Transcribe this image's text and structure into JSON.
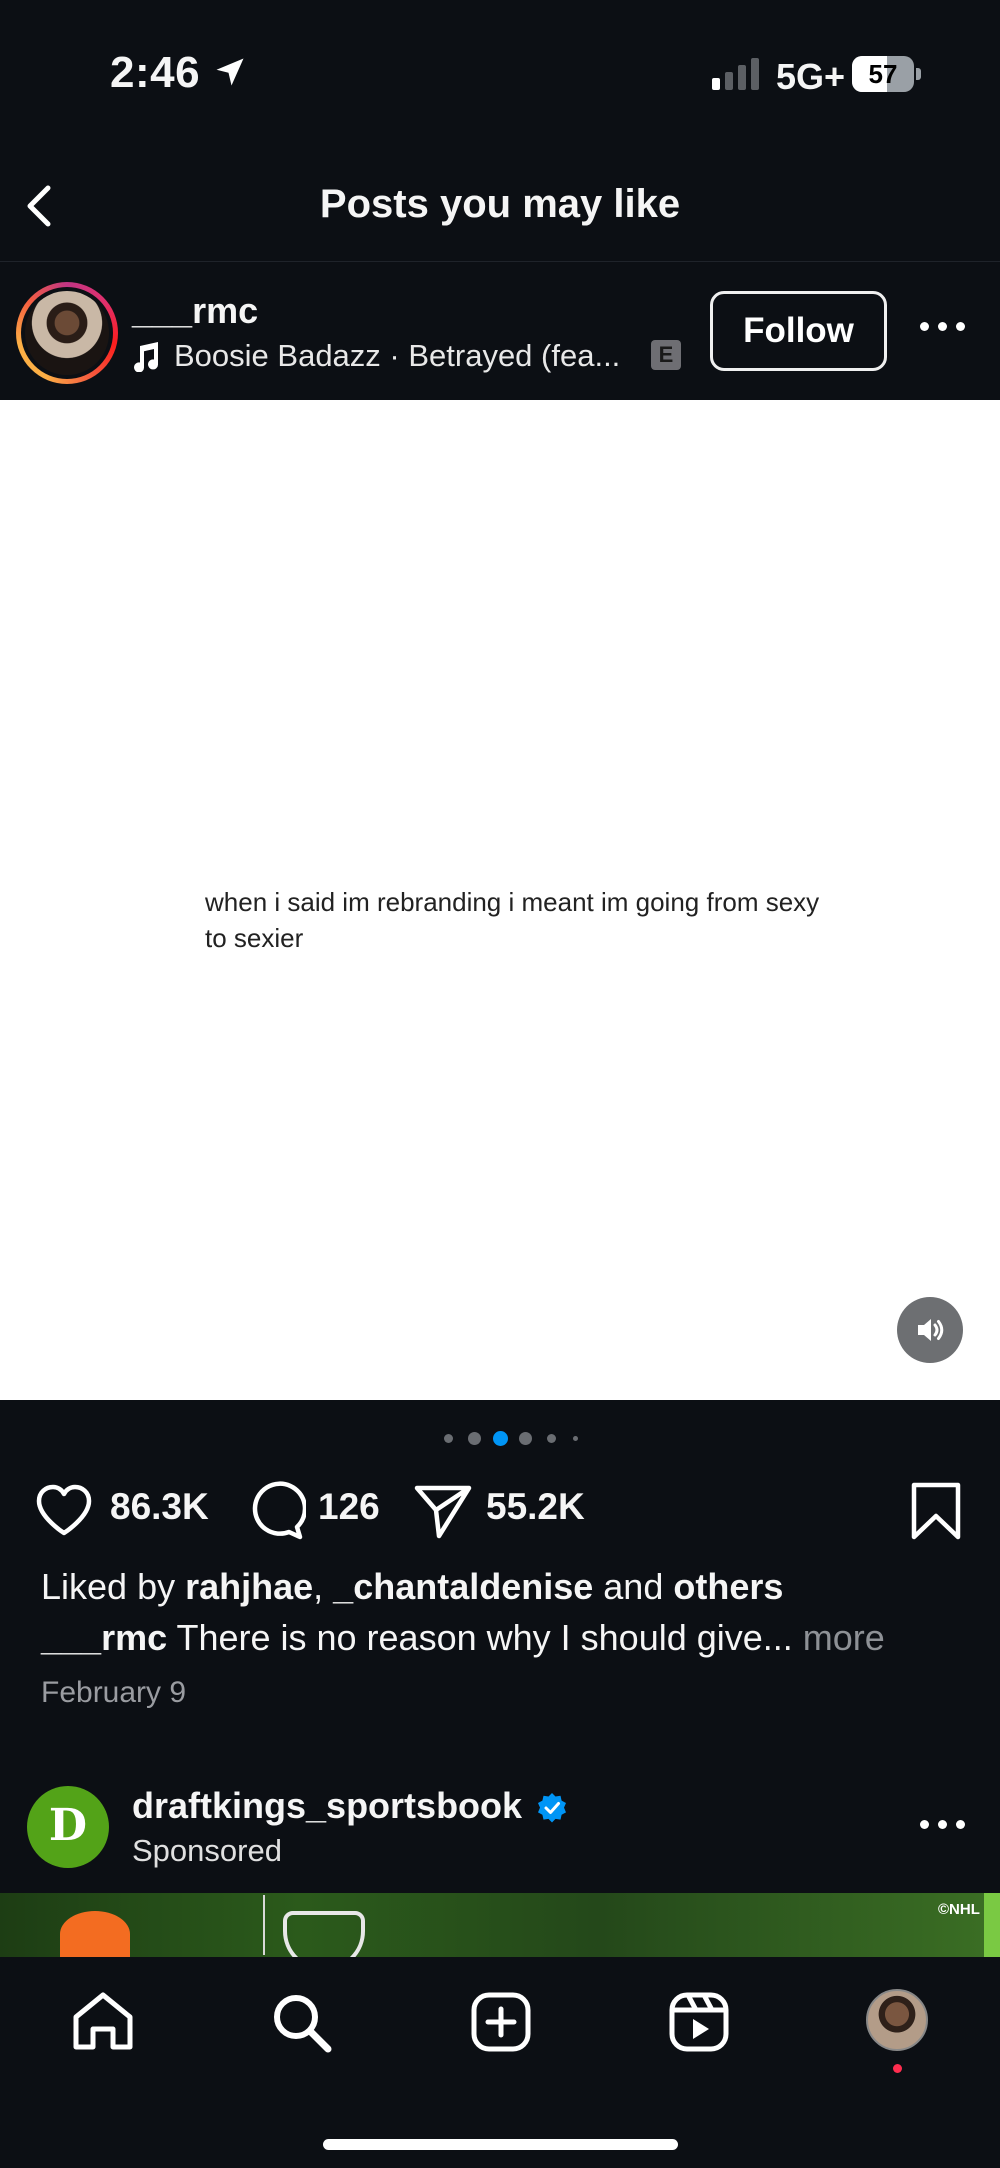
{
  "status_bar": {
    "time": "2:46",
    "network": "5G+",
    "battery_level": "57",
    "battery_percent": 57,
    "signal_bars_active": 1,
    "signal_bars_total": 4
  },
  "header": {
    "title": "Posts you may like",
    "back_icon": "chevron-left-icon"
  },
  "post": {
    "username": "___rmc",
    "audio": "Boosie Badazz · Betrayed (fea...",
    "explicit_badge": "E",
    "follow_label": "Follow",
    "media_text": "when i said im rebranding i meant im going from sexy to sexier",
    "carousel": {
      "total": 6,
      "active_index": 2
    },
    "likes": "86.3K",
    "comments": "126",
    "shares": "55.2K",
    "liked_by": {
      "prefix": "Liked by ",
      "user1": "rahjhae",
      "separator": ", ",
      "user2": "_chantaldenise",
      "middle": " and ",
      "others": "others"
    },
    "caption": {
      "username": "___rmc",
      "text": " There is no reason why I should give...",
      "more": " more"
    },
    "date": "February 9"
  },
  "sponsored_post": {
    "username": "draftkings_sportsbook",
    "subtitle": "Sponsored",
    "avatar_letter": "D",
    "media_credit": "©NHL",
    "verified": true
  },
  "tab_bar": {
    "items": [
      "home-icon",
      "search-icon",
      "create-icon",
      "reels-icon",
      "profile-avatar"
    ]
  },
  "colors": {
    "background": "#0c0f14",
    "accent_blue": "#0095f6",
    "sponsor_green": "#53a318"
  }
}
